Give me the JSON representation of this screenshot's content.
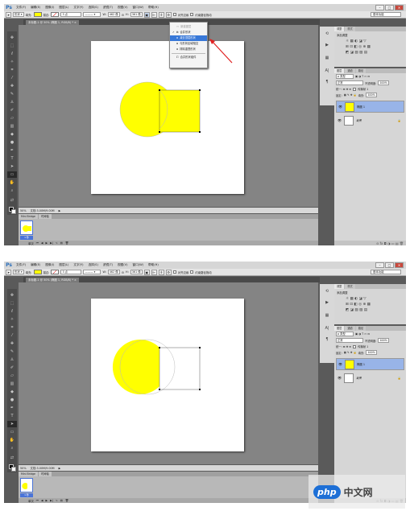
{
  "app": {
    "logo": "Ps",
    "menus": [
      "文件(F)",
      "编辑(E)",
      "图像(I)",
      "图层(L)",
      "文字(Y)",
      "选择(S)",
      "滤镜(T)",
      "视图(V)",
      "窗口(W)",
      "帮助(H)"
    ],
    "window_controls": [
      "–",
      "□",
      "✕"
    ],
    "workspace": "基本功能"
  },
  "options": {
    "fill_label": "填充:",
    "stroke_label": "描边:",
    "stroke_width": "3 点",
    "w_label": "W:",
    "w_value": "462 像",
    "h_label": "H:",
    "h_value": "361 像",
    "align_edges": "对齐边缘",
    "constrain_path": "约束路径拖动",
    "fill_color": "#ffff00",
    "stroke_color": "#e8e8e8"
  },
  "screens": [
    {
      "doc_tab": "未标题-1 @ 50% (椭圆 1, RGB/8) * ×",
      "zoom": "50%",
      "doc_info": "文档:3.00M/9.00M",
      "dropdown": {
        "items": [
          {
            "label": "新建图层",
            "check": "",
            "disabled": true
          },
          {
            "label": "合并形状",
            "check": "✓",
            "disabled": false
          },
          {
            "label": "减去顶层形状",
            "check": "",
            "disabled": false,
            "highlighted": true
          },
          {
            "label": "与形状区域相交",
            "check": "",
            "disabled": false
          },
          {
            "label": "排除重叠形状",
            "check": "",
            "disabled": false
          },
          {
            "label": "合并形状组件",
            "check": "",
            "disabled": false
          }
        ]
      }
    },
    {
      "doc_tab": "未标题-1 @ 50% (椭圆 1, RGB/8) * ×",
      "zoom": "50%",
      "doc_info": "文档:3.00M/9.00M"
    }
  ],
  "mini_panel": {
    "tabs": [
      "Mini Bridge",
      "时间轴"
    ],
    "thumb_label": "1 秒",
    "playback": "单次"
  },
  "adjustments": {
    "tabs": [
      "调整",
      "样式"
    ],
    "title": "添加调整",
    "row1": "☼ ▦ ◐ ◪ ▽",
    "row2": "⊞ ⊡ ◧ ◎ ⊕ ▦",
    "row3": "◩ ◪ ▧ ▨ ▤"
  },
  "layers": {
    "tabs": [
      "图层",
      "通道",
      "路径"
    ],
    "filter": "ρ 类型",
    "blend": "正常",
    "opacity_label": "不透明度:",
    "opacity": "100%",
    "lock_label": "锁定:",
    "fill_label": "填充:",
    "fill_value": "100%",
    "unify_label": "传播帧 1",
    "items": [
      {
        "name": "椭圆 1",
        "selected": true
      },
      {
        "name": "背景",
        "selected": false,
        "lock": "🔒"
      }
    ],
    "footer": "⊝ fx ◘ ◑ ▭ ▤ 🗑"
  },
  "watermark": {
    "badge": "php",
    "text": "中文网"
  }
}
